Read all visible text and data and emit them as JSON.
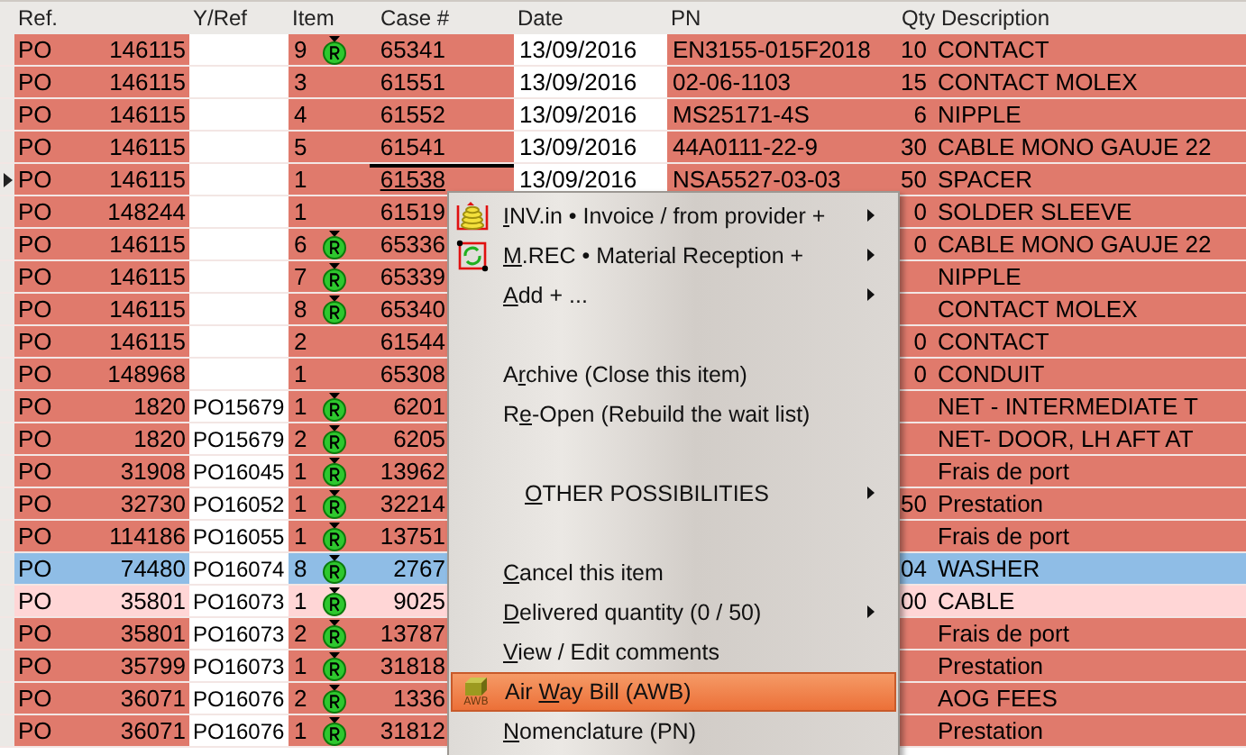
{
  "table": {
    "columns": [
      "Ref.",
      "Y/Ref",
      "Item",
      "Case #",
      "Date",
      "PN",
      "Qty",
      "Description"
    ],
    "rows": [
      {
        "type": "PO",
        "ref": "146115",
        "yref": "",
        "item": "9",
        "received": true,
        "case": "65341",
        "date": "13/09/2016",
        "pn": "EN3155-015F2018",
        "qty": "10",
        "description": "CONTACT",
        "color": "#e07a6c",
        "current": false
      },
      {
        "type": "PO",
        "ref": "146115",
        "yref": "",
        "item": "3",
        "received": false,
        "case": "61551",
        "date": "13/09/2016",
        "pn": "02-06-1103",
        "qty": "15",
        "description": "CONTACT MOLEX",
        "color": "#e07a6c",
        "current": false
      },
      {
        "type": "PO",
        "ref": "146115",
        "yref": "",
        "item": "4",
        "received": false,
        "case": "61552",
        "date": "13/09/2016",
        "pn": "MS25171-4S",
        "qty": "6",
        "description": "NIPPLE",
        "color": "#e07a6c",
        "current": false
      },
      {
        "type": "PO",
        "ref": "146115",
        "yref": "",
        "item": "5",
        "received": false,
        "case": "61541",
        "date": "13/09/2016",
        "pn": "44A0111-22-9",
        "qty": "30",
        "description": "CABLE MONO GAUJE 22",
        "color": "#e07a6c",
        "current": false
      },
      {
        "type": "PO",
        "ref": "146115",
        "yref": "",
        "item": "1",
        "received": false,
        "case": "61538",
        "date": "13/09/2016",
        "pn": "NSA5527-03-03",
        "qty": "50",
        "description": "SPACER",
        "color": "#e07a6c",
        "current": true
      },
      {
        "type": "PO",
        "ref": "148244",
        "yref": "",
        "item": "1",
        "received": false,
        "case": "61519",
        "qty": "0",
        "description": "SOLDER SLEEVE",
        "color": "#e07a6c",
        "current": false
      },
      {
        "type": "PO",
        "ref": "146115",
        "yref": "",
        "item": "6",
        "received": true,
        "case": "65336",
        "qty": "0",
        "description": "CABLE MONO GAUJE 22",
        "color": "#e07a6c",
        "current": false
      },
      {
        "type": "PO",
        "ref": "146115",
        "yref": "",
        "item": "7",
        "received": true,
        "case": "65339",
        "description": "NIPPLE",
        "color": "#e07a6c",
        "current": false
      },
      {
        "type": "PO",
        "ref": "146115",
        "yref": "",
        "item": "8",
        "received": true,
        "case": "65340",
        "description": "CONTACT MOLEX",
        "color": "#e07a6c",
        "current": false
      },
      {
        "type": "PO",
        "ref": "146115",
        "yref": "",
        "item": "2",
        "received": false,
        "case": "61544",
        "qty": "0",
        "description": "CONTACT",
        "color": "#e07a6c",
        "current": false
      },
      {
        "type": "PO",
        "ref": "148968",
        "yref": "",
        "item": "1",
        "received": false,
        "case": "65308",
        "qty": "0",
        "description": "CONDUIT",
        "color": "#e07a6c",
        "current": false
      },
      {
        "type": "PO",
        "ref": "1820",
        "yref": "PO15679",
        "item": "1",
        "received": true,
        "case": "6201",
        "description": "NET - INTERMEDIATE T",
        "color": "#e07a6c",
        "current": false
      },
      {
        "type": "PO",
        "ref": "1820",
        "yref": "PO15679",
        "item": "2",
        "received": true,
        "case": "6205",
        "description": "NET- DOOR, LH AFT AT",
        "color": "#e07a6c",
        "current": false
      },
      {
        "type": "PO",
        "ref": "31908",
        "yref": "PO16045",
        "item": "1",
        "received": true,
        "case": "13962",
        "description": "Frais de port",
        "color": "#e07a6c",
        "current": false
      },
      {
        "type": "PO",
        "ref": "32730",
        "yref": "PO16052",
        "item": "1",
        "received": true,
        "case": "32214",
        "qty": "50",
        "description": "Prestation",
        "color": "#e07a6c",
        "current": false
      },
      {
        "type": "PO",
        "ref": "114186",
        "yref": "PO16055",
        "item": "1",
        "received": true,
        "case": "13751",
        "description": "Frais de port",
        "color": "#e07a6c",
        "current": false
      },
      {
        "type": "PO",
        "ref": "74480",
        "yref": "PO16074",
        "item": "8",
        "received": true,
        "case": "2767",
        "qty": "04",
        "description": "WASHER",
        "color": "#8fbde6",
        "current": false
      },
      {
        "type": "PO",
        "ref": "35801",
        "yref": "PO16073",
        "item": "1",
        "received": true,
        "case": "9025",
        "qty": "00",
        "description": "CABLE",
        "color": "#ffd6d6",
        "current": false
      },
      {
        "type": "PO",
        "ref": "35801",
        "yref": "PO16073",
        "item": "2",
        "received": true,
        "case": "13787",
        "description": "Frais de port",
        "color": "#e07a6c",
        "current": false
      },
      {
        "type": "PO",
        "ref": "35799",
        "yref": "PO16073",
        "item": "1",
        "received": true,
        "case": "31818",
        "description": "Prestation",
        "color": "#e07a6c",
        "current": false
      },
      {
        "type": "PO",
        "ref": "36071",
        "yref": "PO16076",
        "item": "2",
        "received": true,
        "case": "1336",
        "description": "AOG FEES",
        "color": "#e07a6c",
        "current": false
      },
      {
        "type": "PO",
        "ref": "36071",
        "yref": "PO16076",
        "item": "1",
        "received": true,
        "case": "31812",
        "description": "Prestation",
        "color": "#e07a6c",
        "current": false
      }
    ]
  },
  "context_menu": {
    "items": [
      {
        "kind": "item",
        "key": "I",
        "post": "NV.in • Invoice / from provider +",
        "submenu": true,
        "selected": false
      },
      {
        "kind": "item",
        "key": "M",
        "post": ".REC •  Material Reception +",
        "submenu": true,
        "selected": false
      },
      {
        "kind": "item",
        "key": "A",
        "post": "dd + ...",
        "submenu": true,
        "selected": false
      },
      {
        "kind": "spacer"
      },
      {
        "kind": "item",
        "pre": "A",
        "key": "r",
        "post": "chive (Close this item)",
        "submenu": false,
        "selected": false
      },
      {
        "kind": "item",
        "pre": "R",
        "key": "e",
        "post": "-Open  (Rebuild the wait list)",
        "submenu": false,
        "selected": false
      },
      {
        "kind": "spacer"
      },
      {
        "kind": "section",
        "key": "O",
        "post": "THER POSSIBILITIES",
        "submenu": true,
        "selected": false
      },
      {
        "kind": "spacer"
      },
      {
        "kind": "item",
        "key": "C",
        "post": "ancel this item",
        "submenu": false,
        "selected": false
      },
      {
        "kind": "item",
        "key": "D",
        "post": "elivered quantity (0 / 50)",
        "submenu": true,
        "selected": false
      },
      {
        "kind": "item",
        "key": "V",
        "post": "iew / Edit comments",
        "submenu": false,
        "selected": false
      },
      {
        "kind": "item",
        "icon_label": "AWB",
        "pre": "Air ",
        "key": "W",
        "post": "ay Bill (AWB)",
        "submenu": false,
        "selected": true
      },
      {
        "kind": "item",
        "key": "N",
        "post": "omenclature (PN)",
        "submenu": false,
        "selected": false
      }
    ]
  }
}
